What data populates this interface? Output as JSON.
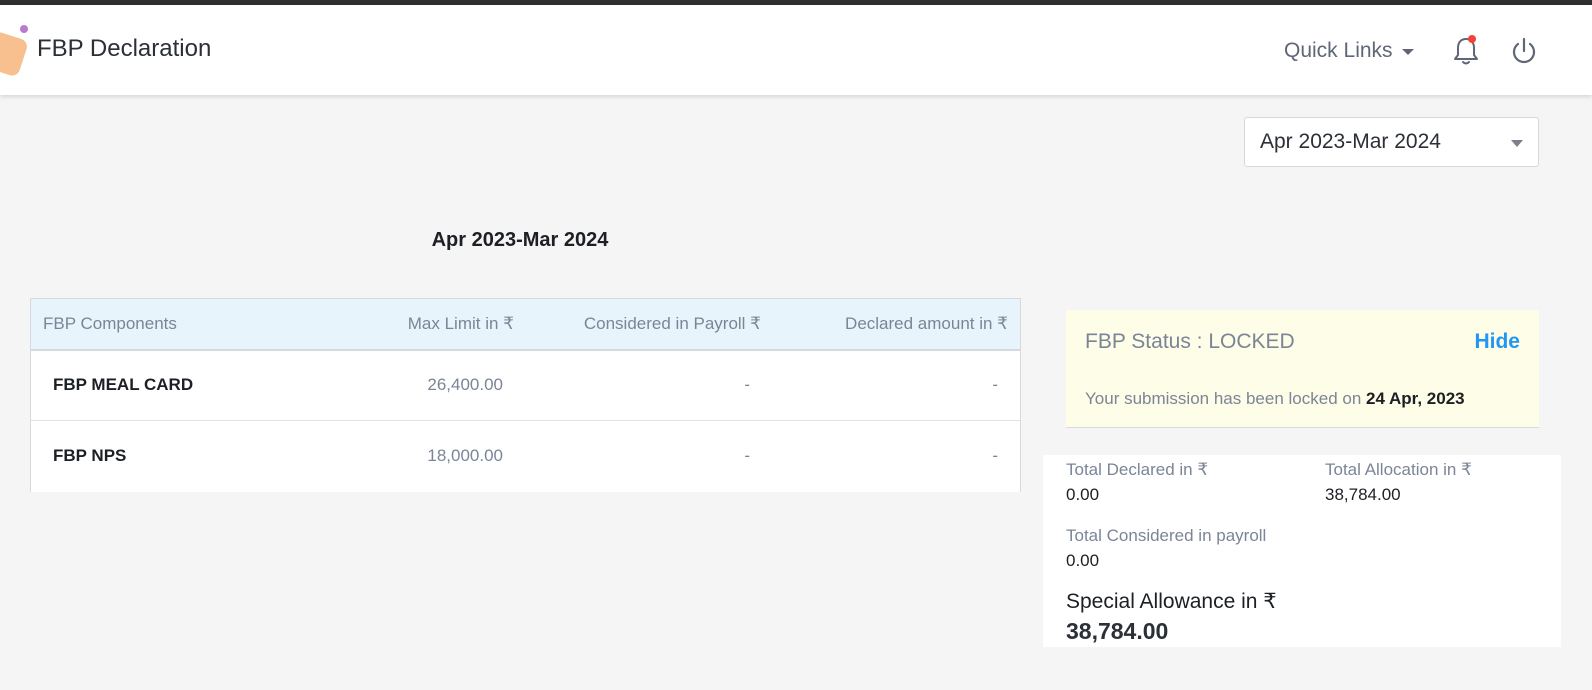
{
  "header": {
    "title": "FBP Declaration",
    "quick_links_label": "Quick Links",
    "icons": [
      "bell-icon",
      "power-icon"
    ],
    "notification_dot_color": "#f44336"
  },
  "year_selector": {
    "selected": "Apr 2023-Mar 2024"
  },
  "period_heading": "Apr 2023-Mar 2024",
  "table": {
    "headers": [
      "FBP Components",
      "Max Limit in ₹",
      "Considered in Payroll ₹",
      "Declared amount in ₹"
    ],
    "rows": [
      {
        "component": "FBP MEAL CARD",
        "max_limit": "26,400.00",
        "considered": "-",
        "declared": "-"
      },
      {
        "component": "FBP NPS",
        "max_limit": "18,000.00",
        "considered": "-",
        "declared": "-"
      }
    ]
  },
  "status": {
    "title": "FBP Status : LOCKED",
    "hide_label": "Hide",
    "message": "Your submission has been locked on",
    "locked_date": "24 Apr, 2023"
  },
  "summary": {
    "total_declared_label": "Total Declared in ₹",
    "total_declared_value": "0.00",
    "total_allocation_label": "Total Allocation in ₹",
    "total_allocation_value": "38,784.00",
    "total_considered_label": "Total Considered in payroll",
    "total_considered_value": "0.00",
    "special_allowance_label": "Special Allowance in ₹",
    "special_allowance_value": "38,784.00"
  },
  "colors": {
    "accent": "#2196f3",
    "table_header_bg": "#e8f4fb",
    "status_bg": "#fdfde8"
  }
}
